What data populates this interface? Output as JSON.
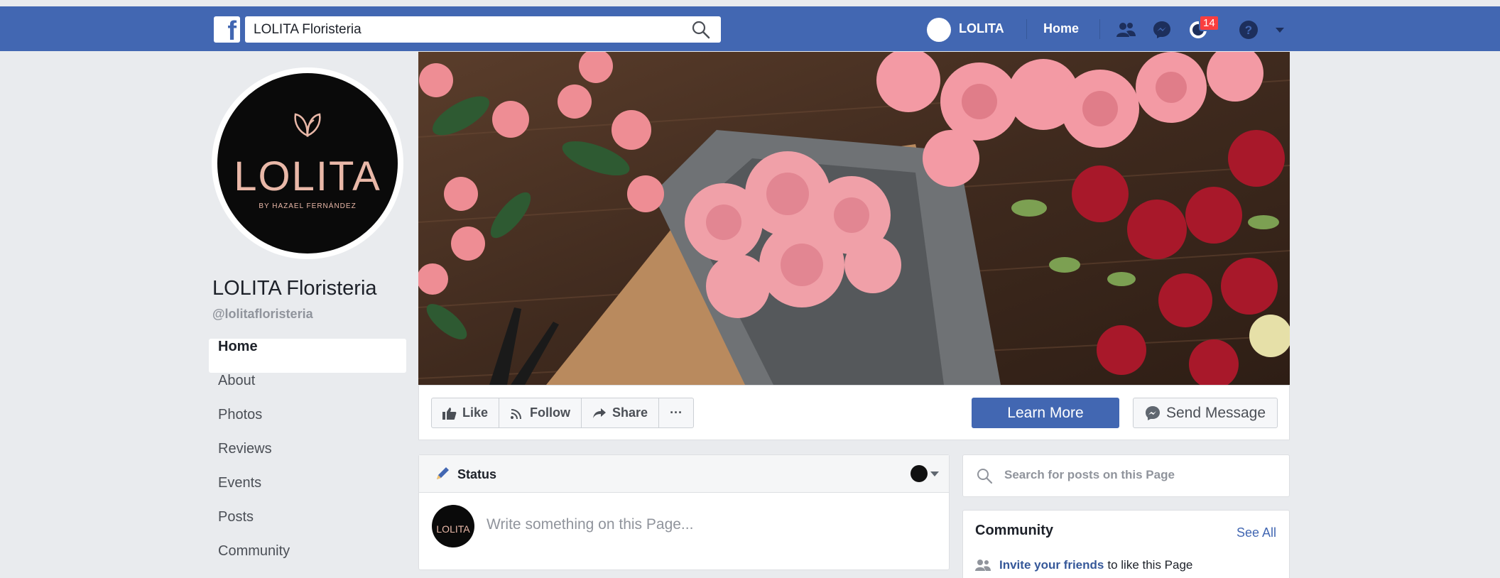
{
  "topbar": {
    "logo": "f",
    "search_value": "LOLITA Floristeria",
    "user_name": "LOLITA",
    "home_label": "Home",
    "notifications_count": "14",
    "icons": [
      "friends-icon",
      "messenger-icon",
      "notifications-icon",
      "help-icon",
      "caret-down-icon"
    ]
  },
  "profile": {
    "logo_text": "LOLITA",
    "logo_sub": "BY HAZAEL FERNÁNDEZ",
    "name": "LOLITA Floristeria",
    "handle": "@lolitafloristeria"
  },
  "leftnav": {
    "items": [
      {
        "label": "Home",
        "active": true
      },
      {
        "label": "About"
      },
      {
        "label": "Photos"
      },
      {
        "label": "Reviews"
      },
      {
        "label": "Events"
      },
      {
        "label": "Posts"
      },
      {
        "label": "Community"
      }
    ]
  },
  "actions": {
    "like": "Like",
    "follow": "Follow",
    "share": "Share",
    "more": "···",
    "learn_more": "Learn More",
    "send_message": "Send Message"
  },
  "composer": {
    "title": "Status",
    "avatar_text": "LOLITA",
    "placeholder": "Write something on this Page..."
  },
  "post_search": {
    "placeholder": "Search for posts on this Page"
  },
  "community": {
    "title": "Community",
    "see_all": "See All",
    "invite_link": "Invite your friends",
    "invite_rest": "to like this Page"
  },
  "colors": {
    "brand_blue": "#4267b2",
    "page_bg": "#e9ebee",
    "badge_red": "#fa3e3e"
  }
}
